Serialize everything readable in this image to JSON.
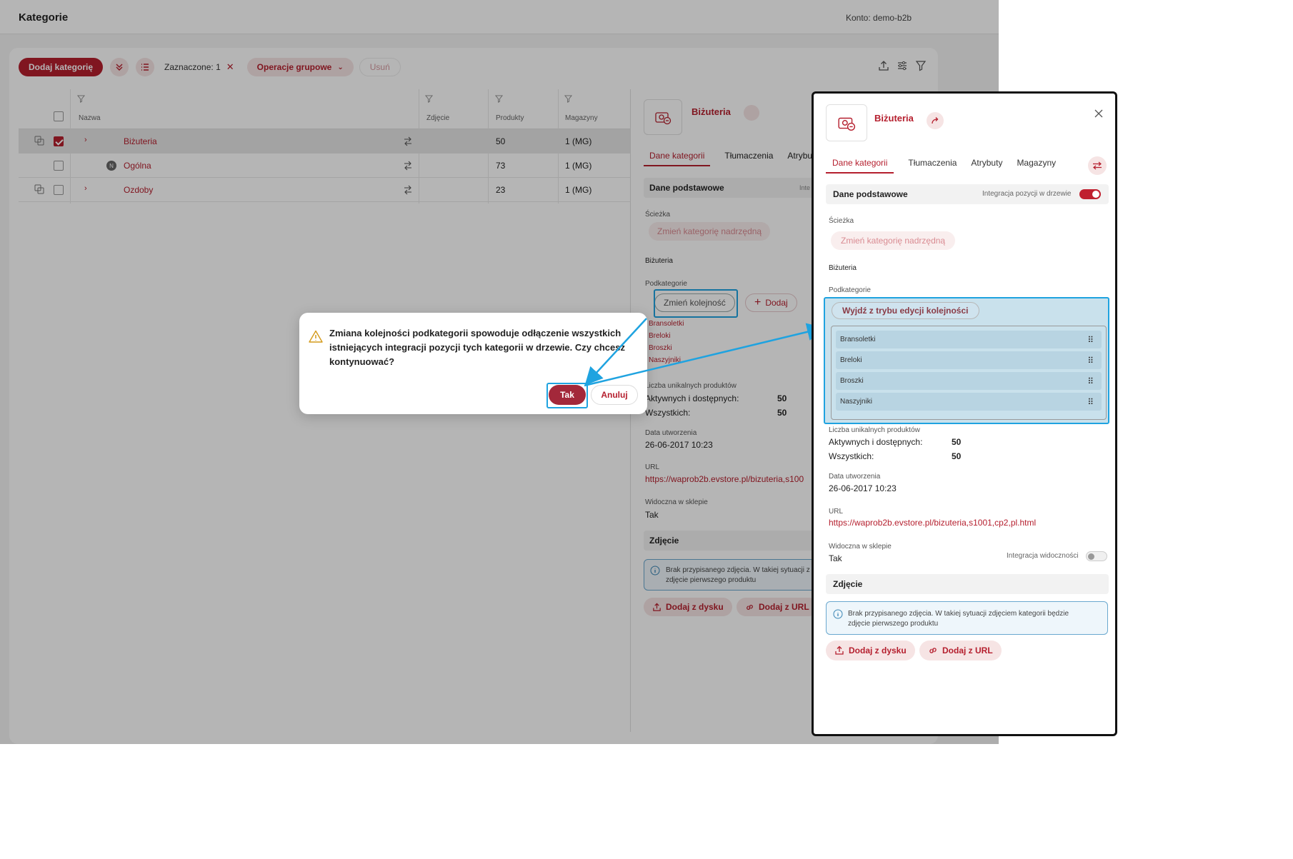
{
  "app": {
    "title": "Kategorie",
    "account": "Konto: demo-b2b"
  },
  "toolbar": {
    "add_category": "Dodaj kategorię",
    "selected": "Zaznaczone: 1",
    "bulk_ops": "Operacje grupowe",
    "delete": "Usuń"
  },
  "table": {
    "headers": [
      "Nazwa",
      "Zdjęcie",
      "Produkty",
      "Magazyny"
    ],
    "rows": [
      {
        "name": "Biżuteria",
        "products": "50",
        "warehouses": "1 (MG)",
        "checked": true
      },
      {
        "name": "Ogólna",
        "badge": "N",
        "products": "73",
        "warehouses": "1 (MG)",
        "checked": false
      },
      {
        "name": "Ozdoby",
        "products": "23",
        "warehouses": "1 (MG)",
        "checked": false
      }
    ]
  },
  "detail": {
    "name": "Biżuteria",
    "tabs": [
      "Dane kategorii",
      "Tłumaczenia",
      "Atrybu"
    ],
    "basic_section": "Dane podstawowe",
    "basic_hint": "Inte",
    "path_label": "Ścieżka",
    "change_parent": "Zmień kategorię nadrzędną",
    "path_value": "Biżuteria",
    "subcategories_label": "Podkategorie",
    "reorder_button": "Zmień kolejność",
    "add_button": "Dodaj",
    "subcategories": [
      "Bransoletki",
      "Breloki",
      "Broszki",
      "Naszyjniki"
    ],
    "unique_label": "Liczba unikalnych produktów",
    "active_label": "Aktywnych i dostępnych:",
    "active_value": "50",
    "all_label": "Wszystkich:",
    "all_value": "50",
    "created_label": "Data utworzenia",
    "created_value": "26-06-2017 10:23",
    "url_label": "URL",
    "url_value": "https://waprob2b.evstore.pl/bizuteria,s100",
    "visible_label": "Widoczna w sklepie",
    "visible_value": "Tak",
    "photo_section": "Zdjęcie",
    "photo_info_1": "Brak przypisanego zdjęcia. W takiej sytuacji z",
    "photo_info_2": "zdjęcie pierwszego produktu",
    "add_from_disk": "Dodaj z dysku",
    "add_from_url": "Dodaj z URL"
  },
  "dialog": {
    "message": "Zmiana kolejności podkategorii spowoduje odłączenie wszystkich istniejących integracji pozycji tych kategorii w drzewie. Czy chcesz kontynuować?",
    "yes": "Tak",
    "cancel": "Anuluj"
  },
  "zoom": {
    "name": "Biżuteria",
    "tabs": [
      "Dane kategorii",
      "Tłumaczenia",
      "Atrybuty",
      "Magazyny"
    ],
    "basic_section": "Dane podstawowe",
    "tree_integration": "Integracja pozycji w drzewie",
    "tree_integration_on": true,
    "path_label": "Ścieżka",
    "change_parent": "Zmień kategorię nadrzędną",
    "path_value": "Biżuteria",
    "subcategories_label": "Podkategorie",
    "exit_reorder": "Wyjdź z trybu edycji kolejności",
    "subcategories": [
      "Bransoletki",
      "Breloki",
      "Broszki",
      "Naszyjniki"
    ],
    "unique_label": "Liczba unikalnych produktów",
    "active_label": "Aktywnych i dostępnych:",
    "active_value": "50",
    "all_label": "Wszystkich:",
    "all_value": "50",
    "created_label": "Data utworzenia",
    "created_value": "26-06-2017 10:23",
    "url_label": "URL",
    "url_value": "https://waprob2b.evstore.pl/bizuteria,s1001,cp2,pl.html",
    "visible_label": "Widoczna w sklepie",
    "visible_value": "Tak",
    "visibility_integration": "Integracja widoczności",
    "visibility_integration_on": false,
    "photo_section": "Zdjęcie",
    "photo_info_1": "Brak przypisanego zdjęcia. W takiej sytuacji zdjęciem kategorii będzie",
    "photo_info_2": "zdjęcie pierwszego produktu",
    "add_from_disk": "Dodaj z dysku",
    "add_from_url": "Dodaj z URL"
  },
  "colors": {
    "brand": "#b51f2e",
    "highlight": "#1fa3e0"
  }
}
